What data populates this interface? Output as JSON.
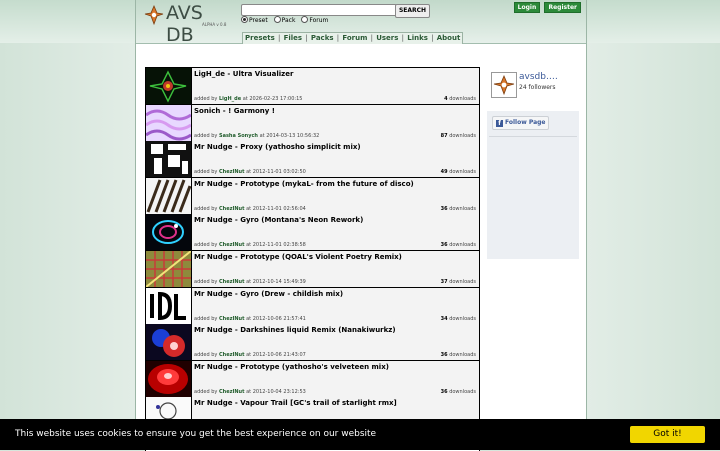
{
  "header": {
    "logo_text": "AVS DB",
    "logo_tag": "ALPHA v 0.8",
    "search_placeholder": "",
    "search_button": "SEARCH",
    "radio_options": [
      "Preset",
      "Pack",
      "Forum"
    ],
    "radio_selected": "Preset",
    "login": "Login",
    "register": "Register"
  },
  "nav": {
    "items": [
      "Presets",
      "Files",
      "Packs",
      "Forum",
      "Users",
      "Links",
      "About"
    ]
  },
  "presets": [
    {
      "title": "LigH_de - Ultra Visualizer",
      "added_by_label": "added by",
      "user": "LigH_de",
      "at_label": "at",
      "date": "2026-02-23 17:00:15",
      "downloads": "4",
      "downloads_label": "downloads",
      "thumb": "green-fractal"
    },
    {
      "title": "Sonich - ! Garmony !",
      "added_by_label": "added by",
      "user": "Sasha Sonych",
      "at_label": "at",
      "date": "2014-03-13 10:56:32",
      "downloads": "87",
      "downloads_label": "downloads",
      "thumb": "violet-waves"
    },
    {
      "title": "Mr Nudge - Proxy (yathosho simplicit mix)",
      "added_by_label": "added by",
      "user": "ChezINut",
      "at_label": "at",
      "date": "2012-11-01 03:02:50",
      "downloads": "49",
      "downloads_label": "downloads",
      "thumb": "bw-blocks"
    },
    {
      "title": "Mr Nudge - Prototype (mykaL- from the future of disco)",
      "added_by_label": "added by",
      "user": "ChezINut",
      "at_label": "at",
      "date": "2012-11-01 02:56:04",
      "downloads": "36",
      "downloads_label": "downloads",
      "thumb": "bw-stripes"
    },
    {
      "title": "Mr Nudge - Gyro (Montana's Neon Rework)",
      "added_by_label": "added by",
      "user": "ChezINut",
      "at_label": "at",
      "date": "2012-11-01 02:38:58",
      "downloads": "36",
      "downloads_label": "downloads",
      "thumb": "neon-ring"
    },
    {
      "title": "Mr Nudge - Prototype (QOAL's Violent Poetry Remix)",
      "added_by_label": "added by",
      "user": "ChezINut",
      "at_label": "at",
      "date": "2012-10-14 15:49:39",
      "downloads": "37",
      "downloads_label": "downloads",
      "thumb": "olive-grid"
    },
    {
      "title": "Mr Nudge - Gyro (Drew - childish mix)",
      "added_by_label": "added by",
      "user": "ChezINut",
      "at_label": "at",
      "date": "2012-10-06 21:57:41",
      "downloads": "34",
      "downloads_label": "downloads",
      "thumb": "bw-glyphs"
    },
    {
      "title": "Mr Nudge - Darkshines liquid Remix (Nanakiwurkz)",
      "added_by_label": "added by",
      "user": "ChezINut",
      "at_label": "at",
      "date": "2012-10-06 21:43:07",
      "downloads": "36",
      "downloads_label": "downloads",
      "thumb": "red-blue-glow"
    },
    {
      "title": "Mr Nudge - Prototype (yathosho's velveteen mix)",
      "added_by_label": "added by",
      "user": "ChezINut",
      "at_label": "at",
      "date": "2012-10-04 23:12:53",
      "downloads": "36",
      "downloads_label": "downloads",
      "thumb": "red-glow"
    },
    {
      "title": "Mr Nudge - Vapour Trail [GC's trail of starlight rmx]",
      "added_by_label": "added by",
      "user": "ChezINut",
      "at_label": "at",
      "date": "",
      "downloads": "",
      "downloads_label": "",
      "thumb": "white-sketch"
    }
  ],
  "facebook": {
    "page_name": "avsdb.…",
    "followers": "24 followers",
    "follow_label": "Follow Page",
    "brand_color": "#3b5998"
  },
  "cookie": {
    "message": "This website uses cookies to ensure you get the best experience on our website",
    "button": "Got it!",
    "button_color": "#f1d600"
  }
}
